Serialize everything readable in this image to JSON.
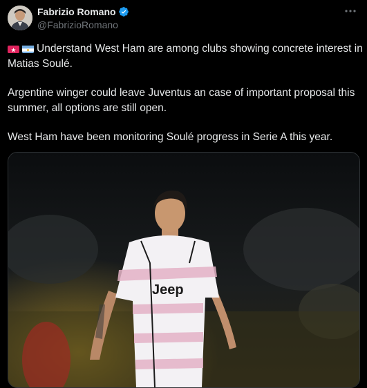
{
  "author": {
    "display_name": "Fabrizio Romano",
    "handle": "@FabrizioRomano",
    "avatar_icon": "avatar-photo",
    "verified_icon": "verified-badge-icon",
    "verified_color": "#1d9bf0"
  },
  "menu": {
    "more_icon": "more-options-icon"
  },
  "tweet": {
    "line1_emojis": [
      "siren-emoji",
      "argentina-flag-emoji"
    ],
    "para1": "Understand West Ham are among clubs showing concrete interest in Matias Soulé.",
    "para2": "Argentine winger could leave Juventus an case of important proposal this summer, all options are still open.",
    "para3": "West Ham have been monitoring Soulé progress in Serie A this year."
  },
  "media": {
    "jersey_text": "Jeep",
    "colors": {
      "jersey_white": "#f3f1f4",
      "jersey_pink": "#e3b2c6",
      "background": "#0c0e10"
    }
  }
}
